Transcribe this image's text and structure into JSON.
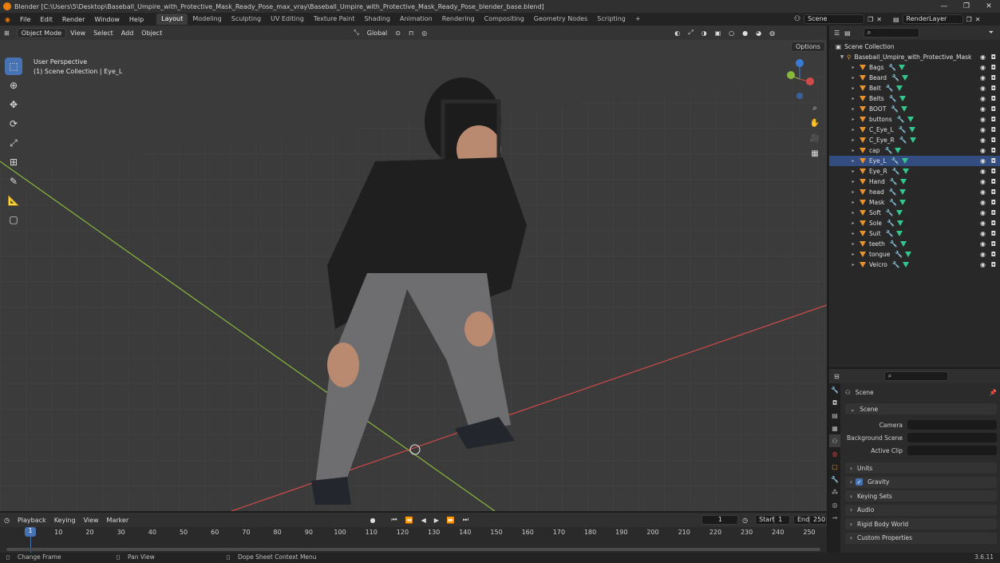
{
  "window": {
    "title": "Blender [C:\\Users\\5\\Desktop\\Baseball_Umpire_with_Protective_Mask_Ready_Pose_max_vray\\Baseball_Umpire_with_Protective_Mask_Ready_Pose_blender_base.blend]"
  },
  "menus": [
    "File",
    "Edit",
    "Render",
    "Window",
    "Help"
  ],
  "workspaces": [
    "Layout",
    "Modeling",
    "Sculpting",
    "UV Editing",
    "Texture Paint",
    "Shading",
    "Animation",
    "Rendering",
    "Compositing",
    "Geometry Nodes",
    "Scripting"
  ],
  "active_workspace": "Layout",
  "scene_name": "Scene",
  "view_layer": "RenderLayer",
  "viewport": {
    "mode": "Object Mode",
    "menu": [
      "View",
      "Select",
      "Add",
      "Object"
    ],
    "transform_orientation": "Global",
    "options_label": "Options",
    "info_line1": "User Perspective",
    "info_line2": "(1) Scene Collection | Eye_L"
  },
  "outliner": {
    "root": "Scene Collection",
    "collection": "Baseball_Umpire_with_Protective_Mask",
    "objects": [
      "Bags",
      "Beard",
      "Belt",
      "Belts",
      "BOOT",
      "buttons",
      "C_Eye_L",
      "C_Eye_R",
      "cap",
      "Eye_L",
      "Eye_R",
      "Hand",
      "head",
      "Mask",
      "Soft",
      "Sole",
      "Suit",
      "teeth",
      "tongue",
      "Velcro"
    ],
    "active_object": "Eye_L"
  },
  "properties": {
    "context": "Scene",
    "panel": "Scene",
    "fields": [
      "Camera",
      "Background Scene",
      "Active Clip"
    ],
    "collapsed_panels": [
      "Units",
      "Gravity",
      "Keying Sets",
      "Audio",
      "Rigid Body World",
      "Custom Properties"
    ],
    "gravity_enabled": true
  },
  "timeline": {
    "menu": [
      "Playback",
      "Keying",
      "View",
      "Marker"
    ],
    "current_frame": "1",
    "start_label": "Start",
    "start": "1",
    "end_label": "End",
    "end": "250",
    "ticks": [
      "10",
      "20",
      "30",
      "40",
      "50",
      "60",
      "70",
      "80",
      "90",
      "100",
      "110",
      "120",
      "130",
      "140",
      "150",
      "160",
      "170",
      "180",
      "190",
      "200",
      "210",
      "220",
      "230",
      "240",
      "250"
    ]
  },
  "status": {
    "left": "Change Frame",
    "mid": "Pan View",
    "right": "Dope Sheet Context Menu",
    "version": "3.6.11"
  },
  "colors": {
    "accent": "#4772b3",
    "object_orange": "#e8932d",
    "mesh_green": "#33c68e",
    "x_axis": "#d04a4a",
    "y_axis": "#88b83a"
  }
}
